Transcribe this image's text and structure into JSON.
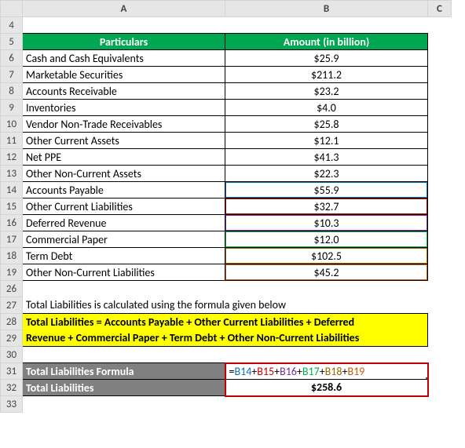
{
  "columns": {
    "A": "A",
    "B": "B",
    "C": "C"
  },
  "header": {
    "particulars": "Particulars",
    "amount": "Amount (in billion)"
  },
  "rows": [
    {
      "n": "6",
      "label": "Cash and Cash Equivalents",
      "value": "$25.9"
    },
    {
      "n": "7",
      "label": "Marketable Securities",
      "value": "$211.2"
    },
    {
      "n": "8",
      "label": "Accounts Receivable",
      "value": "$23.2"
    },
    {
      "n": "9",
      "label": "Inventories",
      "value": "$4.0"
    },
    {
      "n": "10",
      "label": "Vendor Non-Trade Receivables",
      "value": "$25.8"
    },
    {
      "n": "11",
      "label": "Other Current Assets",
      "value": "$12.1"
    },
    {
      "n": "12",
      "label": "Net PPE",
      "value": "$41.3"
    },
    {
      "n": "13",
      "label": "Other Non-Current Assets",
      "value": "$22.3"
    },
    {
      "n": "14",
      "label": "Accounts Payable",
      "value": "$55.9"
    },
    {
      "n": "15",
      "label": "Other Current Liabilities",
      "value": "$32.7"
    },
    {
      "n": "16",
      "label": "Deferred Revenue",
      "value": "$10.3"
    },
    {
      "n": "17",
      "label": "Commercial Paper",
      "value": "$12.0"
    },
    {
      "n": "18",
      "label": "Term Debt",
      "value": "$102.5"
    },
    {
      "n": "19",
      "label": "Other Non-Current Liabilities",
      "value": "$45.2"
    }
  ],
  "rownums": {
    "r4": "4",
    "r5": "5",
    "r26": "26",
    "r27": "27",
    "r28": "28",
    "r29": "29",
    "r30": "30",
    "r31": "31",
    "r32": "32",
    "r33": "33"
  },
  "notes": {
    "desc": "Total Liabilities is calculated using the formula given below",
    "formula_line1": "Total Liabilities = Accounts Payable + Other Current Liabilities + Deferred",
    "formula_line2": "Revenue + Commercial Paper + Term Debt + Other Non-Current Liabilities"
  },
  "result": {
    "label_formula": "Total Liabilities Formula",
    "label_total": "Total Liabilities",
    "total_value": "$258.6"
  },
  "formula": {
    "eq": "=",
    "b14": "B14",
    "b15": "B15",
    "b16": "B16",
    "b17": "B17",
    "b18": "B18",
    "b19": "B19",
    "plus": "+"
  },
  "chart_data": {
    "type": "table",
    "title": "Amount (in billion)",
    "rows": [
      {
        "item": "Cash and Cash Equivalents",
        "amount": 25.9
      },
      {
        "item": "Marketable Securities",
        "amount": 211.2
      },
      {
        "item": "Accounts Receivable",
        "amount": 23.2
      },
      {
        "item": "Inventories",
        "amount": 4.0
      },
      {
        "item": "Vendor Non-Trade Receivables",
        "amount": 25.8
      },
      {
        "item": "Other Current Assets",
        "amount": 12.1
      },
      {
        "item": "Net PPE",
        "amount": 41.3
      },
      {
        "item": "Other Non-Current Assets",
        "amount": 22.3
      },
      {
        "item": "Accounts Payable",
        "amount": 55.9
      },
      {
        "item": "Other Current Liabilities",
        "amount": 32.7
      },
      {
        "item": "Deferred Revenue",
        "amount": 10.3
      },
      {
        "item": "Commercial Paper",
        "amount": 12.0
      },
      {
        "item": "Term Debt",
        "amount": 102.5
      },
      {
        "item": "Other Non-Current Liabilities",
        "amount": 45.2
      }
    ],
    "total_liabilities": 258.6
  }
}
